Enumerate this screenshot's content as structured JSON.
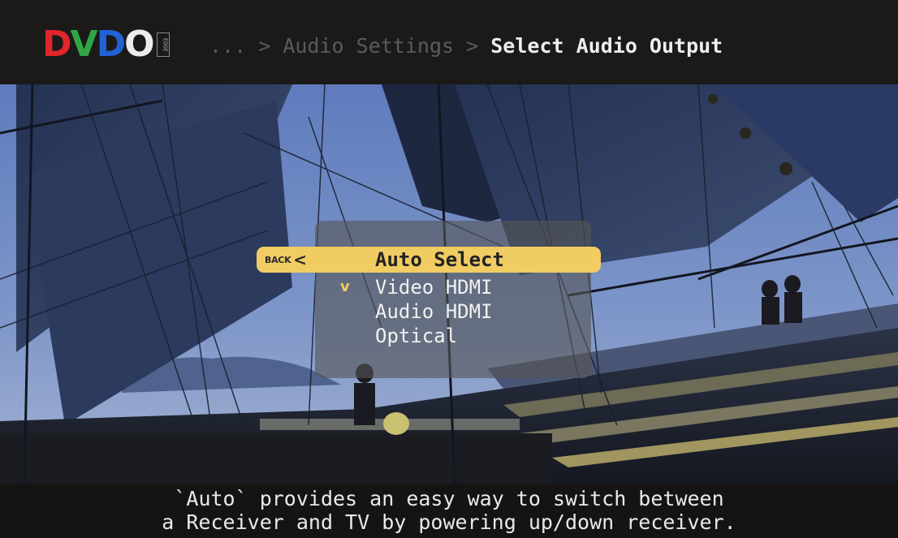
{
  "logo": {
    "letters": [
      "D",
      "V",
      "D",
      "O"
    ],
    "badge": "EDGE",
    "colors": [
      "#e0262b",
      "#2fa645",
      "#1f63d6",
      "#ececec"
    ]
  },
  "breadcrumb": {
    "ellipsis": "...",
    "separator": ">",
    "parent": "Audio Settings",
    "current": "Select Audio Output"
  },
  "menu": {
    "back_label": "BACK",
    "back_arrow": "<",
    "checkmark": "v",
    "options": [
      {
        "label": "Auto Select"
      },
      {
        "label": "Video HDMI"
      },
      {
        "label": "Audio HDMI"
      },
      {
        "label": "Optical"
      }
    ],
    "highlighted_option": "Auto Select",
    "checked_option": "Video HDMI",
    "highlight_color": "#f0cc63"
  },
  "help_text": {
    "line1": "`Auto` provides an easy way to switch between",
    "line2": "a Receiver and TV by powering up/down receiver."
  }
}
